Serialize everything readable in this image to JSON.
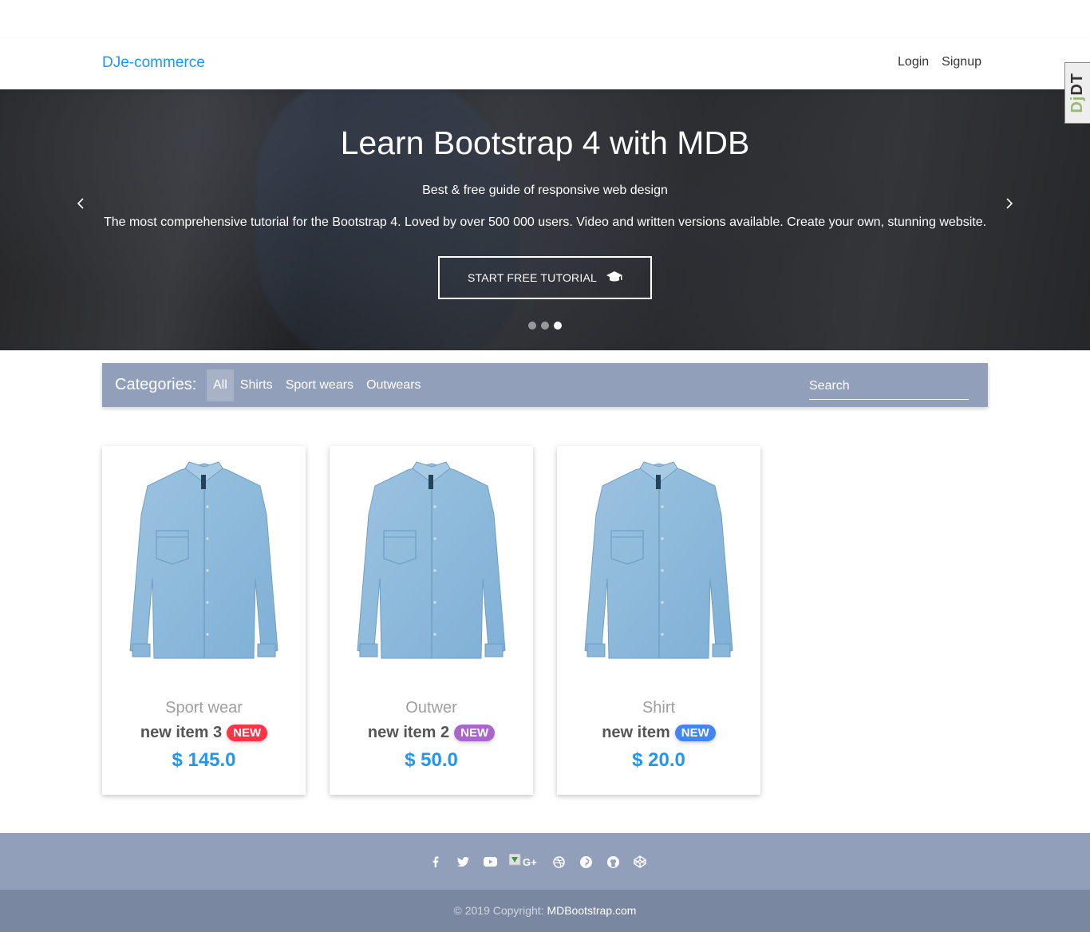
{
  "navbar": {
    "brand": "DJe-commerce",
    "links": [
      "Login",
      "Signup"
    ]
  },
  "debug_toolbar": {
    "label": "DjDT"
  },
  "carousel": {
    "title": "Learn Bootstrap 4 with MDB",
    "subtitle": "Best & free guide of responsive web design",
    "description": "The most comprehensive tutorial for the Bootstrap 4. Loved by over 500 000 users. Video and written versions available. Create your own, stunning website.",
    "button_label": "START FREE TUTORIAL",
    "button_icon": "graduation-cap-icon",
    "prev_icon": "chevron-left-icon",
    "next_icon": "chevron-right-icon",
    "slide_count": 3,
    "active_slide": 3
  },
  "categories": {
    "label": "Categories:",
    "items": [
      "All",
      "Shirts",
      "Sport wears",
      "Outwears"
    ],
    "active": "All",
    "search_placeholder": "Search"
  },
  "products": [
    {
      "category": "Sport wear",
      "name": "new item 3",
      "badge": "NEW",
      "badge_color": "#ff3547",
      "price": "$ 145.0"
    },
    {
      "category": "Outwer",
      "name": "new item 2",
      "badge": "NEW",
      "badge_color": "#aa66cc",
      "price": "$ 50.0"
    },
    {
      "category": "Shirt",
      "name": "new item",
      "badge": "NEW",
      "badge_color": "#4285f4",
      "price": "$ 20.0"
    }
  ],
  "footer": {
    "social_icons": [
      "facebook-icon",
      "twitter-icon",
      "youtube-icon",
      "google-plus-icon",
      "dribbble-icon",
      "pinterest-icon",
      "github-icon",
      "codepen-icon"
    ],
    "copyright_prefix": "© 2019 Copyright:",
    "copyright_link": "MDBootstrap.com"
  },
  "colors": {
    "primary": "#2196f3",
    "slate": "#929fba",
    "slate_dark": "#7987a1"
  }
}
